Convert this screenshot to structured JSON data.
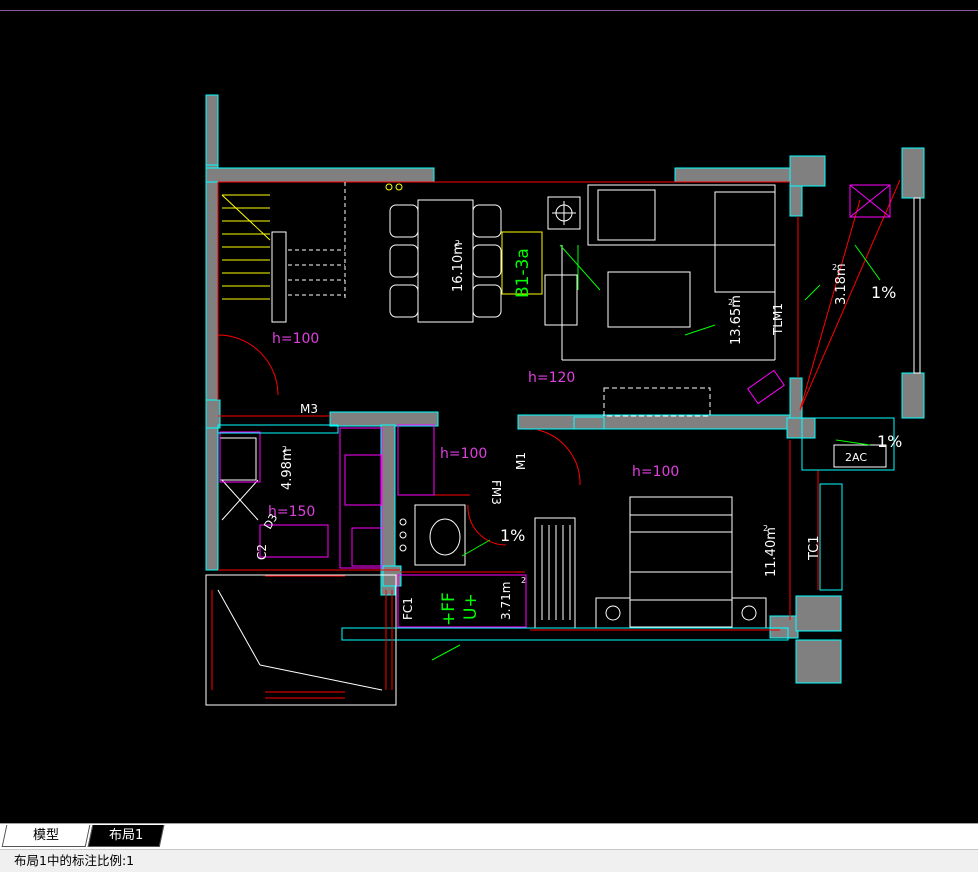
{
  "drawing": {
    "area_labels": {
      "dining": "16.10m",
      "living": "13.65m",
      "balcony": "3.18m",
      "kitchen": "4.98m",
      "bath": "3.71m",
      "bedroom": "11.40m"
    },
    "superscript": "2",
    "heights": {
      "h100_a": "h=100",
      "h120": "h=120",
      "h100_b": "h=100",
      "h100_c": "h=100",
      "h150": "h=150"
    },
    "door_tags": {
      "m3": "M3",
      "m1": "M1",
      "fm3": "FM3",
      "tlm1": "TLM1",
      "tc1": "TC1",
      "fc1": "FC1",
      "c2": "C2",
      "b13a": "B1-3a",
      "ffu": "+FF",
      "ffu2": "U+",
      "ac2": "2AC",
      "d3": "D3"
    },
    "slopes": {
      "s1": "1%",
      "s2": "1%",
      "s3": "1%"
    },
    "colors": {
      "wall": "#808080",
      "wall_edge": "#00ffff",
      "red": "#ff0000",
      "magenta": "#ff00ff",
      "white": "#ffffff",
      "yellow": "#ffff00",
      "green": "#00ff00",
      "text_magenta": "#e040e0"
    }
  },
  "tabs": [
    {
      "label": "模型"
    },
    {
      "label": "布局1"
    }
  ],
  "status": {
    "text": "布局1中的标注比例:1"
  }
}
